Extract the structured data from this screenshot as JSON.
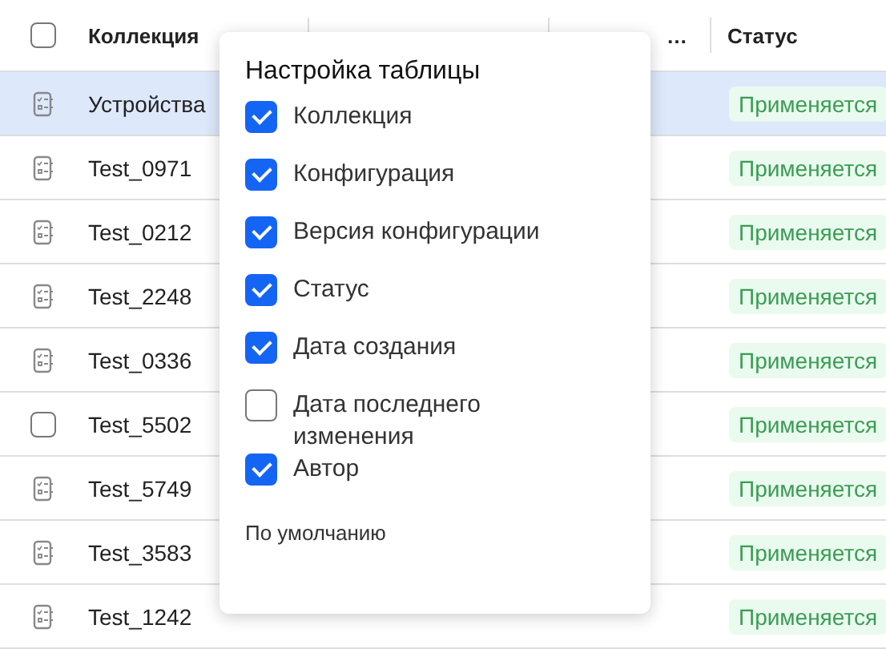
{
  "table": {
    "header_checked": false,
    "columns": [
      {
        "label": "Коллекция"
      },
      {},
      {
        "label": "…"
      },
      {
        "label": "Статус"
      }
    ],
    "rows": [
      {
        "kind": "document",
        "selected": true,
        "name": "Устройства",
        "column_2": "",
        "column_3": "",
        "status": "Применяется"
      },
      {
        "kind": "document",
        "selected": false,
        "name": "Test_0971",
        "column_2": "",
        "column_3": "",
        "status": "Применяется"
      },
      {
        "kind": "document",
        "selected": false,
        "name": "Test_0212",
        "column_2": "",
        "column_3": "",
        "status": "Применяется"
      },
      {
        "kind": "document",
        "selected": false,
        "name": "Test_2248",
        "column_2": "",
        "column_3": "",
        "status": "Применяется"
      },
      {
        "kind": "document",
        "selected": false,
        "name": "Test_0336",
        "column_2": "",
        "column_3": "",
        "status": "Применяется"
      },
      {
        "kind": "checkbox",
        "selected": false,
        "name": "Test_5502",
        "column_2": "",
        "column_3": "",
        "status": "Применяется"
      },
      {
        "kind": "document",
        "selected": false,
        "name": "Test_5749",
        "column_2": "",
        "column_3": "",
        "status": "Применяется"
      },
      {
        "kind": "document",
        "selected": false,
        "name": "Test_3583",
        "column_2": "",
        "column_3": "",
        "status": "Применяется"
      },
      {
        "kind": "document",
        "selected": false,
        "name": "Test_1242",
        "column_2": "",
        "column_3": "",
        "status": "Применяется"
      }
    ]
  },
  "popover": {
    "title": "Настройка таблицы",
    "options": [
      {
        "label": "Коллекция",
        "checked": true
      },
      {
        "label": "Конфигурация",
        "checked": true
      },
      {
        "label": "Версия конфигурации",
        "checked": true
      },
      {
        "label": "Статус",
        "checked": true
      },
      {
        "label": "Дата создания",
        "checked": true
      },
      {
        "label": "Дата последнего изменения",
        "checked": false
      },
      {
        "label": "Автор",
        "checked": true
      }
    ],
    "reset": "По умолчанию"
  }
}
